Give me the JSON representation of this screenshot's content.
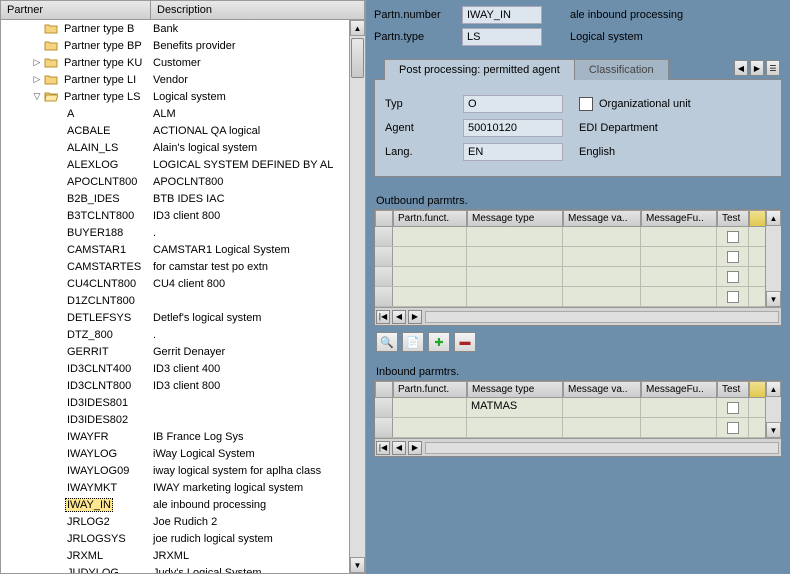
{
  "tree": {
    "header_partner": "Partner",
    "header_desc": "Description",
    "folders": [
      {
        "id": "B",
        "label": "Partner type B",
        "desc": "Bank",
        "expandable": false
      },
      {
        "id": "BP",
        "label": "Partner type BP",
        "desc": "Benefits provider",
        "expandable": false
      },
      {
        "id": "KU",
        "label": "Partner type KU",
        "desc": "Customer",
        "expandable": true
      },
      {
        "id": "LI",
        "label": "Partner type LI",
        "desc": "Vendor",
        "expandable": true
      },
      {
        "id": "LS",
        "label": "Partner type LS",
        "desc": "Logical system",
        "expandable": true,
        "expanded": true
      }
    ],
    "ls_children": [
      {
        "p": "A",
        "d": "ALM"
      },
      {
        "p": "ACBALE",
        "d": "ACTIONAL QA logical"
      },
      {
        "p": "ALAIN_LS",
        "d": "Alain's logical system"
      },
      {
        "p": "ALEXLOG",
        "d": "LOGICAL SYSTEM DEFINED BY AL"
      },
      {
        "p": "APOCLNT800",
        "d": "APOCLNT800"
      },
      {
        "p": "B2B_IDES",
        "d": "BTB IDES IAC"
      },
      {
        "p": "B3TCLNT800",
        "d": "ID3 client  800"
      },
      {
        "p": "BUYER188",
        "d": "."
      },
      {
        "p": "CAMSTAR1",
        "d": "CAMSTAR1 Logical System"
      },
      {
        "p": "CAMSTARTES",
        "d": "for camstar test po extn"
      },
      {
        "p": "CU4CLNT800",
        "d": "CU4 client 800"
      },
      {
        "p": "D1ZCLNT800",
        "d": ""
      },
      {
        "p": "DETLEFSYS",
        "d": "Detlef's logical system"
      },
      {
        "p": "DTZ_800",
        "d": "."
      },
      {
        "p": "GERRIT",
        "d": "Gerrit Denayer"
      },
      {
        "p": "ID3CLNT400",
        "d": "ID3 client 400"
      },
      {
        "p": "ID3CLNT800",
        "d": "ID3 client 800"
      },
      {
        "p": "ID3IDES801",
        "d": ""
      },
      {
        "p": "ID3IDES802",
        "d": ""
      },
      {
        "p": "IWAYFR",
        "d": "IB France Log Sys"
      },
      {
        "p": "IWAYLOG",
        "d": "iWay Logical System"
      },
      {
        "p": "IWAYLOG09",
        "d": "iway logical system for aplha class"
      },
      {
        "p": "IWAYMKT",
        "d": "IWAY marketing logical system"
      },
      {
        "p": "IWAY_IN",
        "d": "ale inbound processing",
        "selected": true
      },
      {
        "p": "JRLOG2",
        "d": "Joe Rudich 2"
      },
      {
        "p": "JRLOGSYS",
        "d": "joe rudich logical system"
      },
      {
        "p": "JRXML",
        "d": "JRXML"
      },
      {
        "p": "JUDYLOG",
        "d": "Judy's Logical System"
      }
    ]
  },
  "header": {
    "partn_number_label": "Partn.number",
    "partn_number_value": "IWAY_IN",
    "partn_number_text": "ale inbound processing",
    "partn_type_label": "Partn.type",
    "partn_type_value": "LS",
    "partn_type_text": "Logical system"
  },
  "tabs": {
    "active": "Post processing: permitted agent",
    "inactive": "Classification",
    "rows": {
      "typ_label": "Typ",
      "typ_value": "O",
      "typ_check_label": "Organizational unit",
      "agent_label": "Agent",
      "agent_value": "50010120",
      "agent_text": "EDI Department",
      "lang_label": "Lang.",
      "lang_value": "EN",
      "lang_text": "English"
    }
  },
  "outbound": {
    "title": "Outbound parmtrs.",
    "cols": {
      "pf": "Partn.funct.",
      "mt": "Message type",
      "mv": "Message va..",
      "mf": "MessageFu..",
      "test": "Test"
    },
    "rows": []
  },
  "inbound": {
    "title": "Inbound parmtrs.",
    "cols": {
      "pf": "Partn.funct.",
      "mt": "Message type",
      "mv": "Message va..",
      "mf": "MessageFu..",
      "test": "Test"
    },
    "rows": [
      {
        "pf": "",
        "mt": "MATMAS",
        "mv": "",
        "mf": "",
        "test": false
      }
    ]
  }
}
